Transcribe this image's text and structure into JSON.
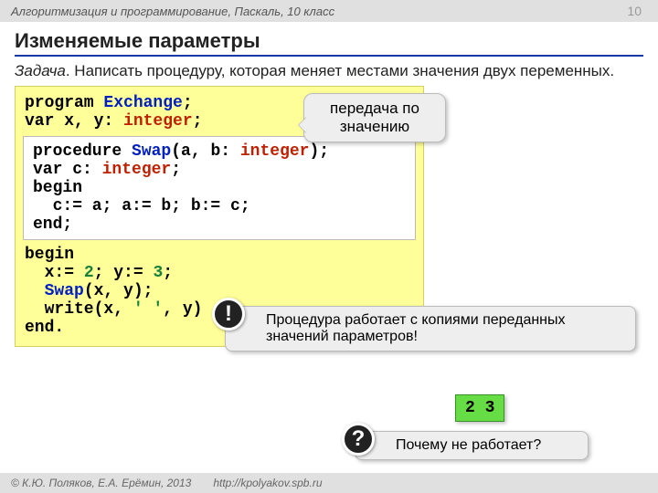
{
  "header": {
    "course": "Алгоритмизация и программирование, Паскаль, 10 класс",
    "page": "10"
  },
  "title": "Изменяемые параметры",
  "task": {
    "label": "Задача",
    "text": ". Написать процедуру, которая меняет местами значения двух переменных."
  },
  "code": {
    "l1a": "program ",
    "l1b": "Exchange",
    "l1c": ";",
    "l2a": "var x, y: ",
    "l2b": "integer",
    "l2c": ";",
    "p1a": "procedure ",
    "p1b": "Swap",
    "p1c": "(a, b: ",
    "p1d": "integer",
    "p1e": ");",
    "p2a": "var c: ",
    "p2b": "integer",
    "p2c": ";",
    "p3": "begin",
    "p4": "  c:= a; a:= b; b:= c;",
    "p5": "end;",
    "b1": "begin",
    "b2a": "  x:= ",
    "b2b": "2",
    "b2c": "; y:= ",
    "b2d": "3",
    "b2e": ";",
    "b3a": "  ",
    "b3b": "Swap",
    "b3c": "(x, y);",
    "b4a": "  write(x, ",
    "b4b": "' '",
    "b4c": ", y)",
    "b5": "end."
  },
  "callout1": "передача по значению",
  "note1": "Процедура работает с копиями переданных значений параметров!",
  "badge1": "!",
  "output": "2 3",
  "note2": "Почему не работает?",
  "badge2": "?",
  "footer": {
    "copyright": "© К.Ю. Поляков, Е.А. Ерёмин, 2013",
    "url": "http://kpolyakov.spb.ru"
  }
}
